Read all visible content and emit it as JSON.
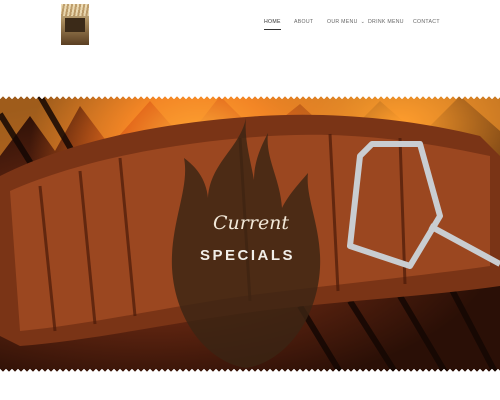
{
  "logo": {
    "name": "restaurant-logo"
  },
  "nav": {
    "items": [
      {
        "label": "HOME",
        "active": true
      },
      {
        "label": "ABOUT",
        "active": false
      },
      {
        "label": "OUR MENU",
        "active": false,
        "has_dropdown": true
      },
      {
        "label": "DRINK MENU",
        "active": false
      },
      {
        "label": "CONTACT",
        "active": false
      }
    ]
  },
  "hero": {
    "script_title": "Current",
    "title": "SPECIALS"
  },
  "colors": {
    "flame_overlay": "#3a2414",
    "text_light": "#f2efe9",
    "nav_text": "#666666"
  }
}
